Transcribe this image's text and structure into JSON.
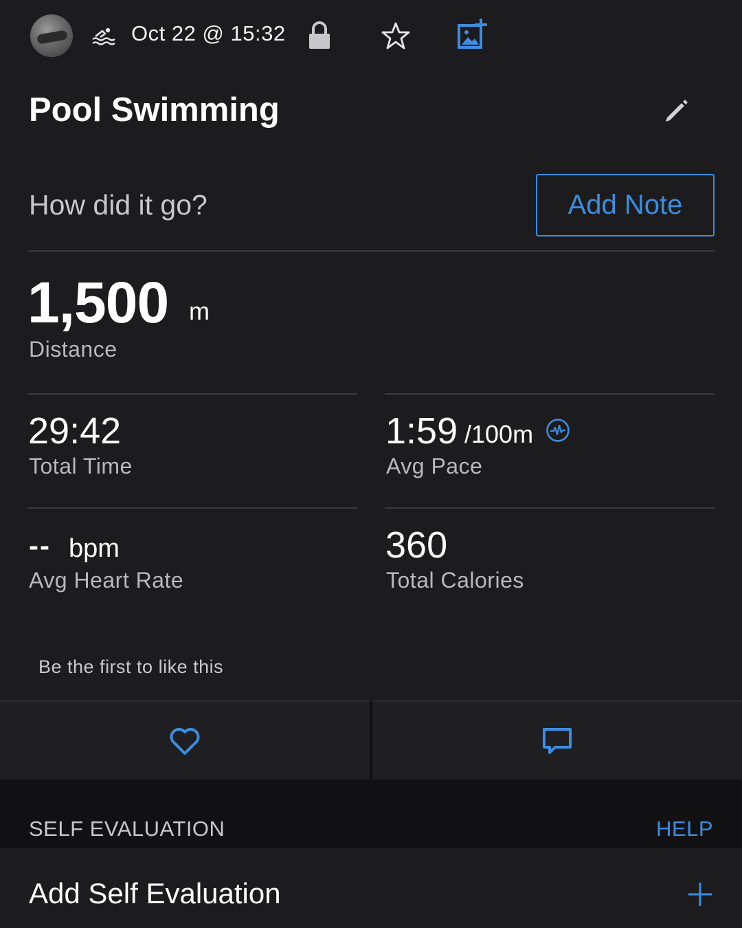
{
  "header": {
    "date": "Oct 22 @ 15:32",
    "icons": [
      "avatar",
      "swim-icon",
      "lock-icon",
      "star-icon",
      "add-photo-icon"
    ]
  },
  "activity": {
    "title": "Pool Swimming",
    "note_prompt": "How did it go?",
    "add_note_label": "Add Note"
  },
  "stats": {
    "distance": {
      "value": "1,500",
      "unit": "m",
      "label": "Distance"
    },
    "total_time": {
      "value": "29:42",
      "label": "Total Time"
    },
    "avg_pace": {
      "value": "1:59",
      "unit": "/100m",
      "label": "Avg Pace"
    },
    "avg_heart_rate": {
      "value": "--",
      "unit": "bpm",
      "label": "Avg Heart Rate"
    },
    "total_calories": {
      "value": "360",
      "label": "Total Calories"
    }
  },
  "social": {
    "likes_text": "Be the first to like this"
  },
  "self_evaluation": {
    "section_title": "SELF EVALUATION",
    "help_label": "HELP",
    "add_label": "Add Self Evaluation"
  },
  "colors": {
    "background": "#1c1c1e",
    "accent": "#3d8de0",
    "label": "#b8b8bd"
  }
}
